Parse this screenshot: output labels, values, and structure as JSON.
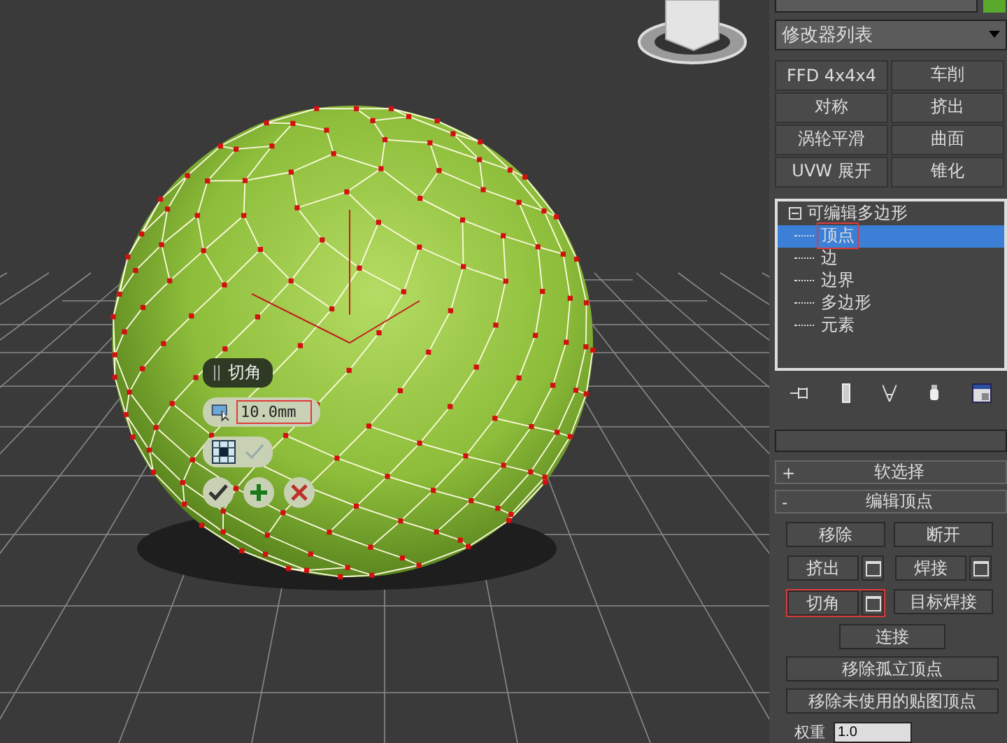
{
  "modifier_list": {
    "label": "修改器列表"
  },
  "modifier_buttons": [
    "FFD 4x4x4",
    "车削",
    "对称",
    "挤出",
    "涡轮平滑",
    "曲面",
    "UVW 展开",
    "锥化"
  ],
  "stack": {
    "label": "可编辑多边形",
    "expanded": true,
    "children": [
      {
        "label": "顶点",
        "selected": true,
        "highlighted": true
      },
      {
        "label": "边",
        "selected": false,
        "highlighted": false
      },
      {
        "label": "边界",
        "selected": false,
        "highlighted": false
      },
      {
        "label": "多边形",
        "selected": false,
        "highlighted": false
      },
      {
        "label": "元素",
        "selected": false,
        "highlighted": false
      }
    ]
  },
  "rollouts": [
    {
      "sign": "+",
      "title": "软选择"
    },
    {
      "sign": "-",
      "title": "编辑顶点"
    }
  ],
  "edit_vertices": [
    {
      "label": "移除",
      "kind": "half",
      "highlighted": false
    },
    {
      "label": "断开",
      "kind": "half",
      "highlighted": false
    },
    {
      "label": "挤出",
      "kind": "settings",
      "highlighted": false
    },
    {
      "label": "焊接",
      "kind": "settings",
      "highlighted": false
    },
    {
      "label": "切角",
      "kind": "settings",
      "highlighted": true
    },
    {
      "label": "目标焊接",
      "kind": "half",
      "highlighted": false
    },
    {
      "label": "连接",
      "kind": "center",
      "highlighted": false
    },
    {
      "label": "移除孤立顶点",
      "kind": "full",
      "highlighted": false
    },
    {
      "label": "移除未使用的贴图顶点",
      "kind": "full",
      "highlighted": false
    }
  ],
  "weight": {
    "label": "权重",
    "value": "1.0"
  },
  "caddy": {
    "title": "切角",
    "value": "10.0mm",
    "highlighted": true
  }
}
